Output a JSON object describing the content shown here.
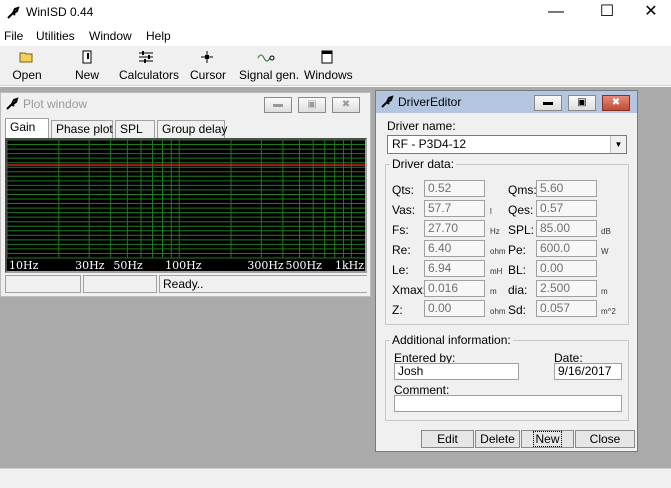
{
  "window": {
    "title": "WinISD 0.44",
    "minimize_icon": "minimize-icon",
    "maximize_icon": "maximize-icon",
    "close_icon": "close-icon"
  },
  "menu": {
    "items": [
      "File",
      "Utilities",
      "Window",
      "Help"
    ]
  },
  "toolbar": {
    "buttons": [
      {
        "label": "Open",
        "icon": "open-folder-icon"
      },
      {
        "label": "New",
        "icon": "new-driver-icon"
      },
      {
        "label": "Calculators",
        "icon": "calculators-icon"
      },
      {
        "label": "Cursor",
        "icon": "cursor-icon"
      },
      {
        "label": "Signal gen.",
        "icon": "signal-gen-icon"
      },
      {
        "label": "Windows",
        "icon": "windows-icon"
      }
    ]
  },
  "plot_window": {
    "title": "Plot window",
    "tabs": [
      "Gain",
      "Phase plot",
      "SPL",
      "Group delay"
    ],
    "active_tab": "Gain",
    "x_ticks": [
      "10Hz",
      "30Hz",
      "50Hz",
      "100Hz",
      "300Hz",
      "500Hz",
      "1kHz"
    ],
    "status": [
      "",
      "",
      "Ready.."
    ],
    "colors": {
      "background": "#000000",
      "grid": "#1f7a1f",
      "curve": "#d02020"
    }
  },
  "driver_editor": {
    "title": "DriverEditor",
    "driver_name_label": "Driver name:",
    "driver_name": "RF - P3D4-12",
    "driver_data_label": "Driver data:",
    "params": {
      "qts": {
        "label": "Qts:",
        "value": "0.52",
        "unit": ""
      },
      "qms": {
        "label": "Qms:",
        "value": "5.60",
        "unit": ""
      },
      "vas": {
        "label": "Vas:",
        "value": "57.7",
        "unit": "l"
      },
      "qes": {
        "label": "Qes:",
        "value": "0.57",
        "unit": ""
      },
      "fs": {
        "label": "Fs:",
        "value": "27.70",
        "unit": "Hz"
      },
      "spl": {
        "label": "SPL:",
        "value": "85.00",
        "unit": "dB"
      },
      "re": {
        "label": "Re:",
        "value": "6.40",
        "unit": "ohm"
      },
      "pe": {
        "label": "Pe:",
        "value": "600.0",
        "unit": "W"
      },
      "le": {
        "label": "Le:",
        "value": "6.94",
        "unit": "mH"
      },
      "bl": {
        "label": "BL:",
        "value": "0.00",
        "unit": ""
      },
      "xmax": {
        "label": "Xmax:",
        "value": "0.016",
        "unit": "m"
      },
      "dia": {
        "label": "dia:",
        "value": "2.500",
        "unit": "m"
      },
      "z": {
        "label": "Z:",
        "value": "0.00",
        "unit": "ohm"
      },
      "sd": {
        "label": "Sd:",
        "value": "0.057",
        "unit": "m^2"
      }
    },
    "additional_label": "Additional information:",
    "entered_by_label": "Entered by:",
    "entered_by": "Josh",
    "date_label": "Date:",
    "date": "9/16/2017",
    "comment_label": "Comment:",
    "comment": "",
    "buttons": {
      "edit": "Edit",
      "delete": "Delete",
      "new": "New",
      "close": "Close"
    }
  }
}
